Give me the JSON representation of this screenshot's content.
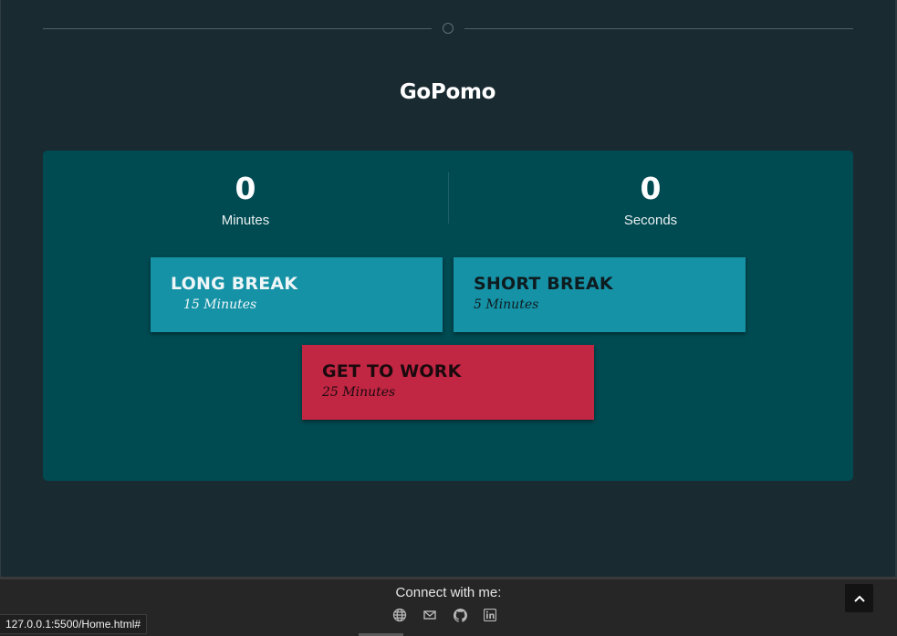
{
  "app": {
    "title": "GoPomo"
  },
  "timer": {
    "minutes": "0",
    "minutes_label": "Minutes",
    "seconds": "0",
    "seconds_label": "Seconds"
  },
  "modes": {
    "long_break": {
      "title": "LONG BREAK",
      "duration": "15 Minutes"
    },
    "short_break": {
      "title": "SHORT BREAK",
      "duration": "5 Minutes"
    },
    "work": {
      "title": "GET TO WORK",
      "duration": "25 Minutes"
    }
  },
  "footer": {
    "connect_label": "Connect with me:",
    "icons": [
      "globe-icon",
      "mail-icon",
      "github-icon",
      "linkedin-icon"
    ]
  },
  "status_bar": {
    "url": "127.0.0.1:5500/Home.html#"
  },
  "colors": {
    "background": "#192b31",
    "panel": "#004a52",
    "break_card": "#1692a6",
    "work_card": "#c12643",
    "footer": "#262626"
  }
}
